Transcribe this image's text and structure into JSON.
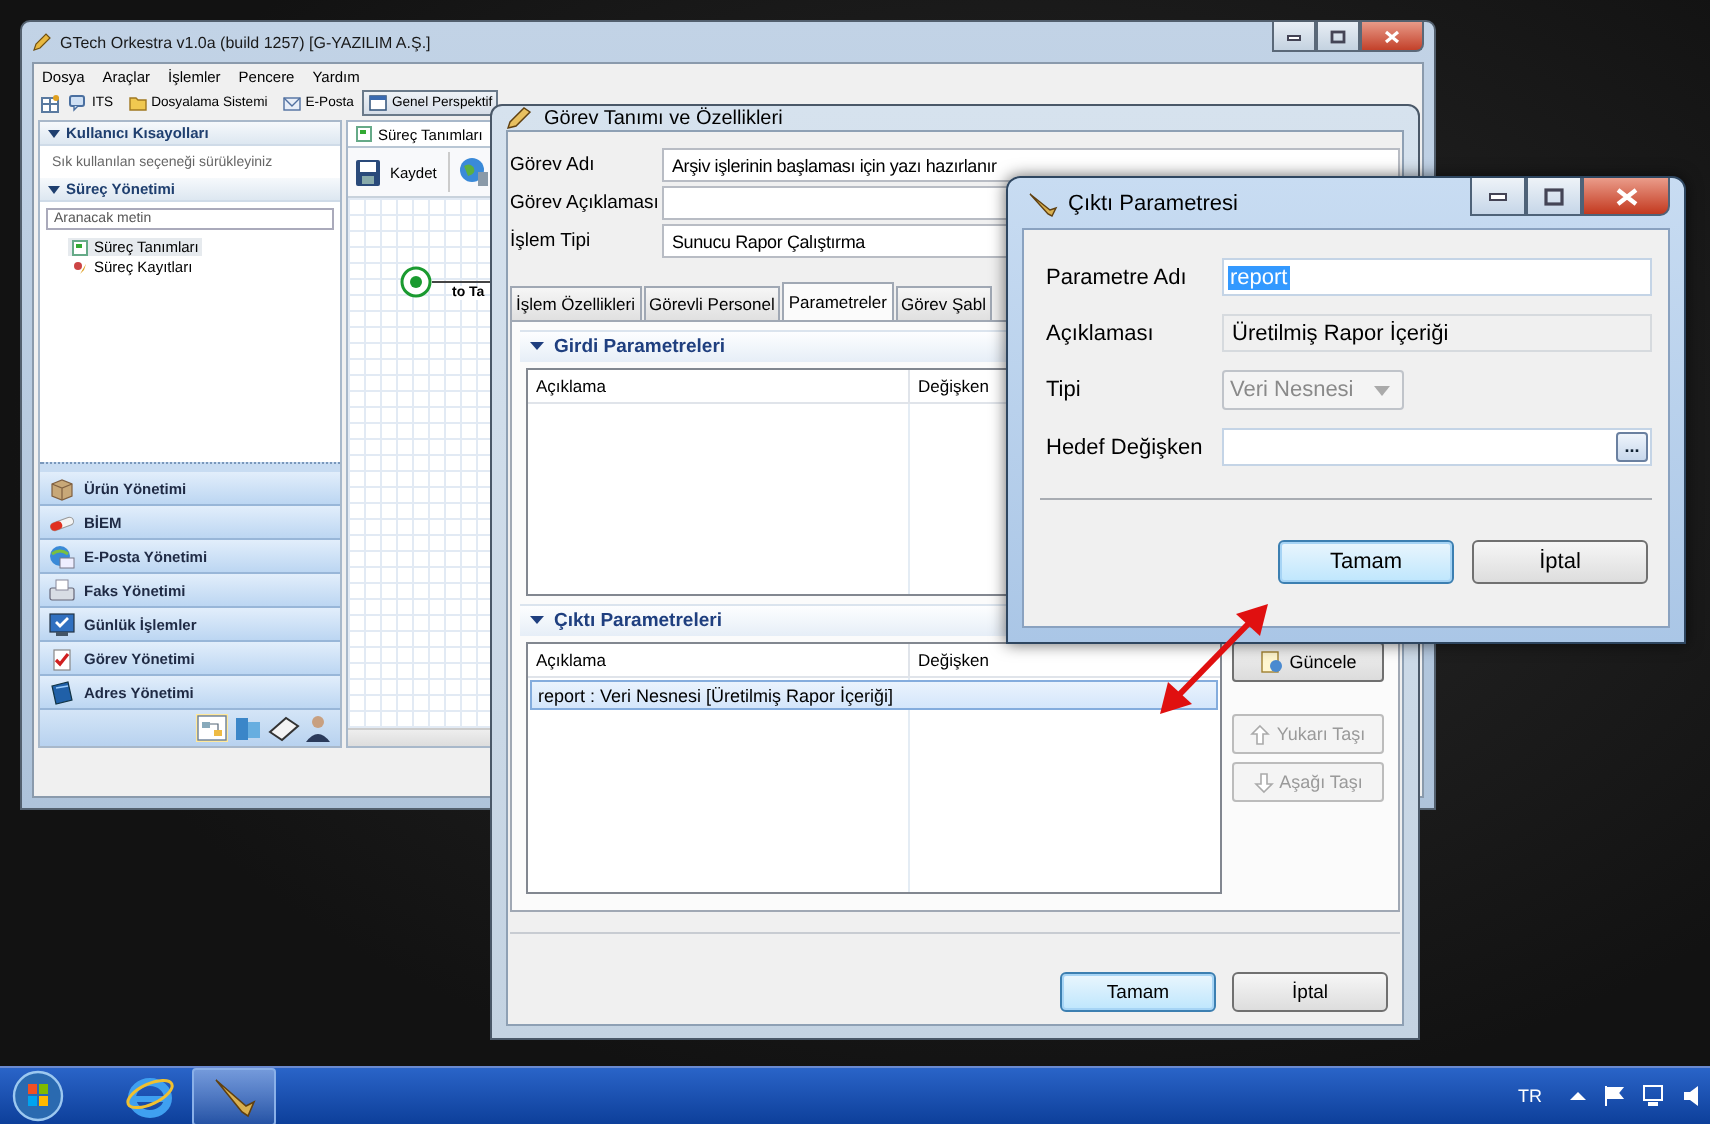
{
  "app_window": {
    "title": "GTech Orkestra v1.0a (build 1257) [G-YAZILIM A.Ş.]",
    "menu": [
      "Dosya",
      "Araçlar",
      "İşlemler",
      "Pencere",
      "Yardım"
    ],
    "toolbar": [
      {
        "label": "ITS",
        "selected": false
      },
      {
        "label": "Dosyalama Sistemi",
        "selected": false
      },
      {
        "label": "E-Posta",
        "selected": false
      },
      {
        "label": "Genel Perspektif",
        "selected": true
      }
    ],
    "sidebar": {
      "shortcuts": {
        "title": "Kullanıcı Kısayolları",
        "expanded": true,
        "hint": "Sık kullanılan seçeneği sürükleyiniz"
      },
      "processes": {
        "title": "Süreç Yönetimi",
        "expanded": true,
        "search": {
          "placeholder": "Aranacak metin"
        },
        "tree": [
          {
            "label": "Süreç Tanımları",
            "selected": true
          },
          {
            "label": "Süreç Kayıtları",
            "selected": false
          }
        ]
      },
      "modules": [
        "Ürün Yönetimi",
        "BİEM",
        "E-Posta Yönetimi",
        "Faks Yönetimi",
        "Günlük İşlemler",
        "Görev Yönetimi",
        "Adres Yönetimi"
      ]
    },
    "editor": {
      "tab": "Süreç Tanımları",
      "save": "Kaydet",
      "node_label": "to Ta"
    }
  },
  "task_dialog": {
    "title": "Görev Tanımı ve Özellikleri",
    "fields": [
      {
        "label": "Görev Adı",
        "value": "Arşiv işlerinin başlaması için yazı hazırlanır"
      },
      {
        "label": "Görev Açıklaması"
      },
      {
        "label": "İşlem Tipi",
        "value": "Sunucu Rapor Çalıştırma"
      }
    ],
    "tabs": [
      {
        "label": "İşlem Özellikleri",
        "selected": false
      },
      {
        "label": "Görevli Personel",
        "selected": false
      },
      {
        "label": "Parametreler",
        "selected": true
      },
      {
        "label": "Görev Şabl",
        "selected": false
      }
    ],
    "input_params": {
      "title": "Girdi Parametreleri",
      "expanded": true,
      "columns": [
        "Açıklama",
        "Değişken"
      ]
    },
    "output_params": {
      "title": "Çıktı Parametreleri",
      "expanded": true,
      "columns": [
        "Açıklama",
        "Değişken"
      ],
      "rows": [
        {
          "description": "report : Veri Nesnesi [Üretilmiş Rapor İçeriği]",
          "selected": true
        }
      ]
    },
    "side_buttons": [
      {
        "label": "Güncele",
        "disabled": false
      },
      {
        "label": "Yukarı Taşı",
        "disabled": true
      },
      {
        "label": "Aşağı Taşı",
        "disabled": true
      }
    ],
    "buttons": [
      {
        "label": "Tamam",
        "default": true
      },
      {
        "label": "İptal",
        "default": false
      }
    ]
  },
  "param_dialog": {
    "title": "Çıktı Parametresi",
    "fields": [
      {
        "kind": "text",
        "label": "Parametre Adı",
        "value": "report",
        "value_selected": true
      },
      {
        "kind": "readonly",
        "label": "Açıklaması",
        "value": "Üretilmiş Rapor İçeriği"
      },
      {
        "kind": "select",
        "label": "Tipi",
        "value": "Veri Nesnesi",
        "disabled": true
      },
      {
        "kind": "browse",
        "label": "Hedef Değişken",
        "button": "..."
      }
    ],
    "buttons": [
      {
        "label": "Tamam",
        "default": true
      },
      {
        "label": "İptal",
        "default": false
      }
    ]
  },
  "taskbar": {
    "language": "TR"
  }
}
